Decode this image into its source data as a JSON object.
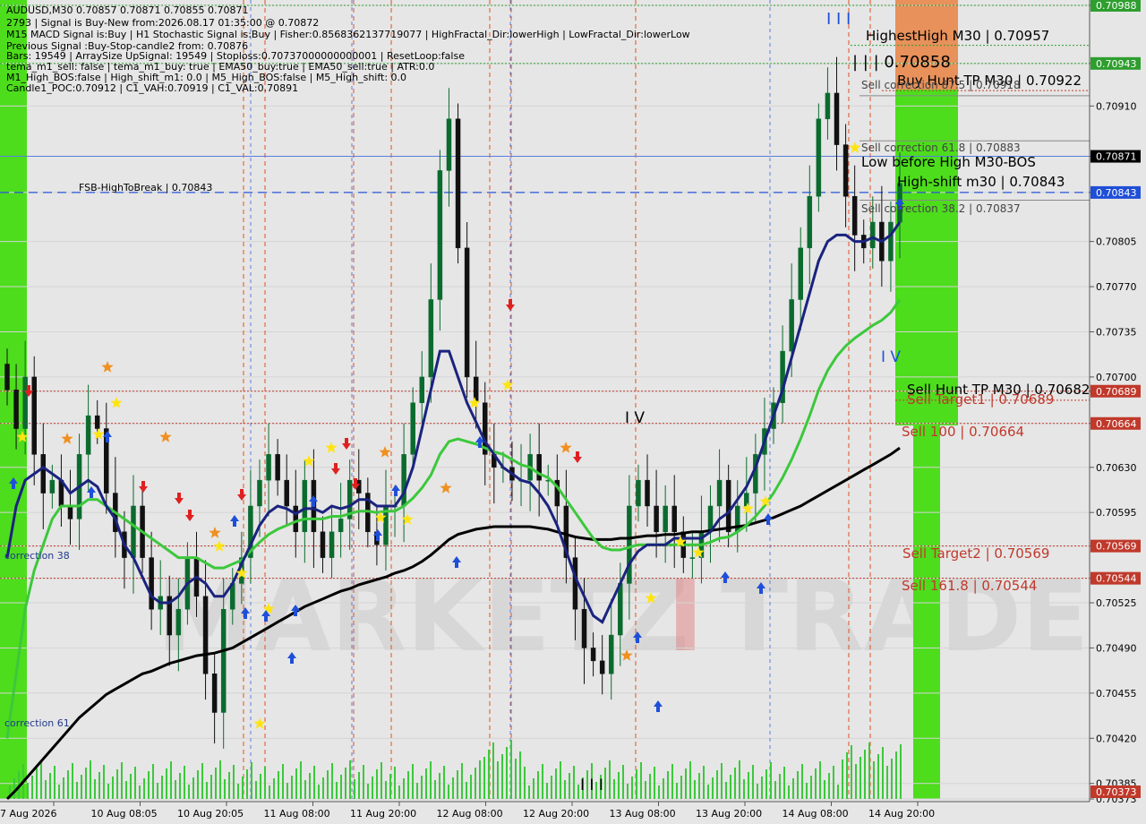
{
  "header": {
    "lines": [
      "AUDUSD,M30  0.70857 0.70871 0.70855 0.70871",
      "2793 | Signal is Buy-New from:2026.08.17 01:35:00 @ 0.70872",
      "M15 MACD Signal is:Buy | H1 Stochastic Signal is:Buy | Fisher:0.8568362137719077 | HighFractal_Dir:lowerHigh | LowFractal_Dir:lowerLow",
      "Previous Signal :Buy-Stop-candle2 from: 0.70876",
      "Bars: 19549 | ArraySize UpSignal: 19549 | Stoploss:0.70737000000000001 | ResetLoop:false",
      "tema_m1_sell: false | tema_m1_buy: true | EMA50_buy:true | EMA50_sell:true | ATR:0.0",
      "M1_High_BOS:false | High_shift_m1: 0.0 | M5_High_BOS:false | M5_High_shift: 0.0",
      "Candle1_POC:0.70912 | C1_VAH:0.70919 | C1_VAL:0.70891"
    ]
  },
  "watermark": {
    "left": "MARKETZ",
    "accent": "I",
    "right": "TRADE"
  },
  "price_axis": {
    "ticks": [
      "0.70988",
      "0.70943",
      "0.70910",
      "0.70871",
      "0.70843",
      "0.70805",
      "0.70770",
      "0.70735",
      "0.70700",
      "0.70689",
      "0.70664",
      "0.70630",
      "0.70595",
      "0.70569",
      "0.70544",
      "0.70525",
      "0.70490",
      "0.70455",
      "0.70420",
      "0.70385",
      "0.70373"
    ],
    "badges": [
      {
        "label": "0.70988",
        "color": "#2e9e2e"
      },
      {
        "label": "0.70943",
        "color": "#2e9e2e"
      },
      {
        "label": "0.70871",
        "color": "#000000"
      },
      {
        "label": "0.70843",
        "color": "#1f4fd8"
      },
      {
        "label": "0.70689",
        "color": "#c0392b"
      },
      {
        "label": "0.70664",
        "color": "#c0392b"
      },
      {
        "label": "0.70569",
        "color": "#c0392b"
      },
      {
        "label": "0.70544",
        "color": "#c0392b"
      },
      {
        "label": "0.70373",
        "color": "#c0392b"
      }
    ]
  },
  "time_axis": {
    "labels": [
      "7 Aug 2026",
      "10 Aug 08:05",
      "10 Aug 20:05",
      "11 Aug 08:00",
      "11 Aug 20:00",
      "12 Aug 08:00",
      "12 Aug 20:00",
      "13 Aug 08:00",
      "13 Aug 20:00",
      "14 Aug 08:00",
      "14 Aug 20:00"
    ]
  },
  "annotations": {
    "highest_high": "HighestHigh   M30 | 0.70957",
    "current_mark": "| | | 0.70858",
    "buy_hunt_tp": "Buy Hunt TP M30 | 0.70922",
    "sell_corr_top": "Sell correction 87.5 | 0.70918",
    "sell_corr_618": "Sell correction 61.8 | 0.70883",
    "low_before_high": "Low before High   M30-BOS",
    "high_shift": "High-shift m30 | 0.70843",
    "sell_corr_382": "Sell correction 38.2 | 0.70837",
    "fsb": "FSB-HighToBreak | 0.70843",
    "sell_hunt_tp": "Sell Hunt TP M30 | 0.70682",
    "sell_target1": "Sell Target1 | 0.70689",
    "sell_100": "Sell 100 | 0.70664",
    "sell_target2": "Sell Target2 | 0.70569",
    "sell_1618": "Sell 161.8 | 0.70544",
    "correction_38": "correction 38",
    "correction_61": "correction 61",
    "wave_iii_top": "I I I",
    "wave_iv": "I V",
    "wave_iv_right": "I V",
    "wave_iii_bottom": "I I I"
  },
  "colors": {
    "background": "#e6e6e6",
    "bull_candle": "#0b6b2e",
    "bear_candle": "#111111",
    "ema_fast": "#1a237e",
    "ema_mid": "#3cc83c",
    "ema_slow": "#000000",
    "green_zone": "#4ddd1c",
    "sell_zone": "#e8915a",
    "red_level": "#c0392b",
    "blue_level": "#1f4fd8"
  },
  "chart_data": {
    "type": "candlestick",
    "symbol": "AUDUSD",
    "timeframe": "M30",
    "ylim": [
      0.70373,
      0.70988
    ],
    "last": {
      "open": 0.70857,
      "high": 0.70871,
      "low": 0.70855,
      "close": 0.70871
    },
    "levels": [
      {
        "name": "HighestHigh M30",
        "value": 0.70957
      },
      {
        "name": "Buy Hunt TP M30",
        "value": 0.70922
      },
      {
        "name": "Sell correction 87.5",
        "value": 0.70918
      },
      {
        "name": "Sell correction 61.8",
        "value": 0.70883
      },
      {
        "name": "High-shift m30",
        "value": 0.70843
      },
      {
        "name": "FSB-HighToBreak",
        "value": 0.70843
      },
      {
        "name": "Sell correction 38.2",
        "value": 0.70837
      },
      {
        "name": "Sell Target1",
        "value": 0.70689
      },
      {
        "name": "Sell Hunt TP M30",
        "value": 0.70682
      },
      {
        "name": "Sell 100",
        "value": 0.70664
      },
      {
        "name": "Sell Target2",
        "value": 0.70569
      },
      {
        "name": "Sell 161.8",
        "value": 0.70544
      }
    ],
    "close_path": [
      0.7069,
      0.7066,
      0.707,
      0.7064,
      0.7061,
      0.7062,
      0.706,
      0.7059,
      0.7064,
      0.7067,
      0.7066,
      0.7061,
      0.7058,
      0.7056,
      0.706,
      0.7056,
      0.7052,
      0.7053,
      0.705,
      0.7052,
      0.7056,
      0.7053,
      0.7047,
      0.7044,
      0.7052,
      0.7054,
      0.7056,
      0.706,
      0.7062,
      0.7064,
      0.7062,
      0.706,
      0.7058,
      0.7062,
      0.7058,
      0.7056,
      0.7058,
      0.7059,
      0.7062,
      0.7061,
      0.7058,
      0.7057,
      0.706,
      0.706,
      0.7064,
      0.7068,
      0.707,
      0.7076,
      0.7086,
      0.709,
      0.708,
      0.707,
      0.7068,
      0.7064,
      0.7063,
      0.7063,
      0.7062,
      0.7062,
      0.7064,
      0.7062,
      0.7062,
      0.706,
      0.7056,
      0.7052,
      0.7049,
      0.7048,
      0.7047,
      0.705,
      0.7054,
      0.706,
      0.7062,
      0.706,
      0.7058,
      0.706,
      0.7058,
      0.7056,
      0.7056,
      0.7058,
      0.706,
      0.7062,
      0.7058,
      0.706,
      0.7061,
      0.7064,
      0.7066,
      0.7068,
      0.7072,
      0.7076,
      0.708,
      0.7084,
      0.709,
      0.7092,
      0.7088,
      0.7084,
      0.7081,
      0.708,
      0.7082,
      0.7079,
      0.7082,
      0.7085
    ],
    "ema_fast": [
      0.7056,
      0.706,
      0.7062,
      0.70625,
      0.7063,
      0.70625,
      0.7062,
      0.7061,
      0.70615,
      0.7062,
      0.70615,
      0.706,
      0.7059,
      0.7057,
      0.7056,
      0.70545,
      0.7053,
      0.70525,
      0.70525,
      0.7053,
      0.7054,
      0.70545,
      0.7054,
      0.7053,
      0.7053,
      0.7054,
      0.70555,
      0.7057,
      0.70585,
      0.70595,
      0.706,
      0.70598,
      0.70594,
      0.70598,
      0.70598,
      0.70595,
      0.706,
      0.70598,
      0.706,
      0.70605,
      0.70605,
      0.706,
      0.706,
      0.706,
      0.7061,
      0.7063,
      0.7066,
      0.7069,
      0.7072,
      0.7072,
      0.707,
      0.7068,
      0.70665,
      0.7065,
      0.7064,
      0.7063,
      0.70625,
      0.7062,
      0.70618,
      0.7061,
      0.706,
      0.70585,
      0.70565,
      0.70545,
      0.7053,
      0.70515,
      0.7051,
      0.70525,
      0.7054,
      0.70555,
      0.70565,
      0.7057,
      0.7057,
      0.7057,
      0.70575,
      0.70575,
      0.70575,
      0.70575,
      0.7058,
      0.7059,
      0.70595,
      0.70605,
      0.70615,
      0.7063,
      0.7065,
      0.7067,
      0.7069,
      0.70715,
      0.7074,
      0.70765,
      0.7079,
      0.70805,
      0.7081,
      0.7081,
      0.70805,
      0.70805,
      0.70808,
      0.70805,
      0.7081,
      0.7082
    ],
    "ema_mid": [
      0.7042,
      0.7047,
      0.7052,
      0.7055,
      0.7057,
      0.7059,
      0.706,
      0.706,
      0.706,
      0.70605,
      0.70605,
      0.706,
      0.70595,
      0.7059,
      0.70585,
      0.7058,
      0.70575,
      0.7057,
      0.70565,
      0.7056,
      0.7056,
      0.7056,
      0.70556,
      0.70552,
      0.70552,
      0.70555,
      0.70558,
      0.70565,
      0.70572,
      0.70578,
      0.70582,
      0.70585,
      0.70588,
      0.7059,
      0.7059,
      0.7059,
      0.70592,
      0.70592,
      0.70594,
      0.70596,
      0.70596,
      0.70595,
      0.70596,
      0.70596,
      0.706,
      0.70606,
      0.70614,
      0.70624,
      0.7064,
      0.7065,
      0.70652,
      0.7065,
      0.70648,
      0.70645,
      0.70642,
      0.7064,
      0.70636,
      0.70632,
      0.7063,
      0.70625,
      0.70622,
      0.70615,
      0.70605,
      0.70595,
      0.70585,
      0.70575,
      0.70568,
      0.70566,
      0.70566,
      0.70568,
      0.7057,
      0.7057,
      0.7057,
      0.7057,
      0.7057,
      0.7057,
      0.7057,
      0.7057,
      0.70572,
      0.70575,
      0.70576,
      0.7058,
      0.70585,
      0.70592,
      0.706,
      0.7061,
      0.70622,
      0.70636,
      0.70652,
      0.7067,
      0.7069,
      0.70705,
      0.70716,
      0.70724,
      0.7073,
      0.70735,
      0.7074,
      0.70744,
      0.7075,
      0.7076
    ],
    "ema_slow": [
      0.70373,
      0.7038,
      0.70388,
      0.70396,
      0.70404,
      0.70412,
      0.7042,
      0.70428,
      0.70436,
      0.70442,
      0.70448,
      0.70454,
      0.70458,
      0.70462,
      0.70466,
      0.7047,
      0.70472,
      0.70475,
      0.70478,
      0.7048,
      0.70482,
      0.70484,
      0.70485,
      0.70486,
      0.70488,
      0.7049,
      0.70494,
      0.70498,
      0.70502,
      0.70506,
      0.7051,
      0.70514,
      0.70518,
      0.70522,
      0.70525,
      0.70528,
      0.70531,
      0.70534,
      0.70536,
      0.70539,
      0.70541,
      0.70543,
      0.70545,
      0.70548,
      0.7055,
      0.70553,
      0.70557,
      0.70562,
      0.70568,
      0.70574,
      0.70578,
      0.7058,
      0.70582,
      0.70583,
      0.70584,
      0.70584,
      0.70584,
      0.70584,
      0.70584,
      0.70583,
      0.70582,
      0.7058,
      0.70578,
      0.70576,
      0.70575,
      0.70574,
      0.70574,
      0.70574,
      0.70575,
      0.70575,
      0.70576,
      0.70577,
      0.70577,
      0.70578,
      0.70578,
      0.70579,
      0.7058,
      0.7058,
      0.70581,
      0.70582,
      0.70583,
      0.70584,
      0.70585,
      0.70587,
      0.70589,
      0.70591,
      0.70594,
      0.70597,
      0.706,
      0.70604,
      0.70608,
      0.70612,
      0.70616,
      0.7062,
      0.70624,
      0.70628,
      0.70632,
      0.70636,
      0.7064,
      0.70645
    ]
  }
}
